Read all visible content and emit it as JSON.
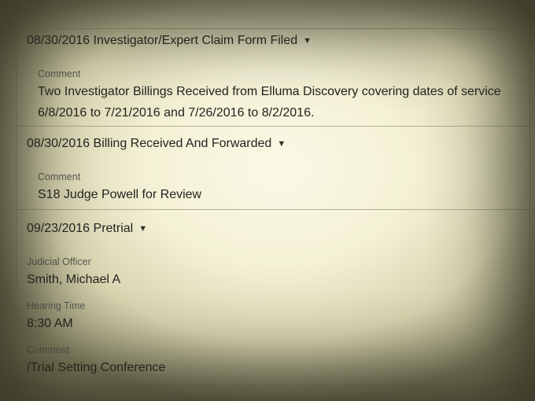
{
  "events": [
    {
      "heading": "08/30/2016 Investigator/Expert Claim Form Filed",
      "fields": [
        {
          "label": "Comment",
          "value": "Two Investigator Billings Received from Elluma Discovery covering dates of service 6/8/2016 to 7/21/2016 and 7/26/2016 to 8/2/2016."
        }
      ]
    },
    {
      "heading": "08/30/2016 Billing Received And Forwarded",
      "fields": [
        {
          "label": "Comment",
          "value": "S18 Judge Powell for Review"
        }
      ]
    },
    {
      "heading": "09/23/2016 Pretrial",
      "fields": [
        {
          "label": "Judicial Officer",
          "value": "Smith, Michael A"
        },
        {
          "label": "Hearing Time",
          "value": "8:30 AM"
        },
        {
          "label": "Comment",
          "value": "/Trial Setting Conference"
        }
      ]
    }
  ],
  "icons": {
    "expand": "caret-down-icon"
  },
  "colors": {
    "text": "#23241f",
    "label": "#5a5a52",
    "divider": "#96947a"
  }
}
